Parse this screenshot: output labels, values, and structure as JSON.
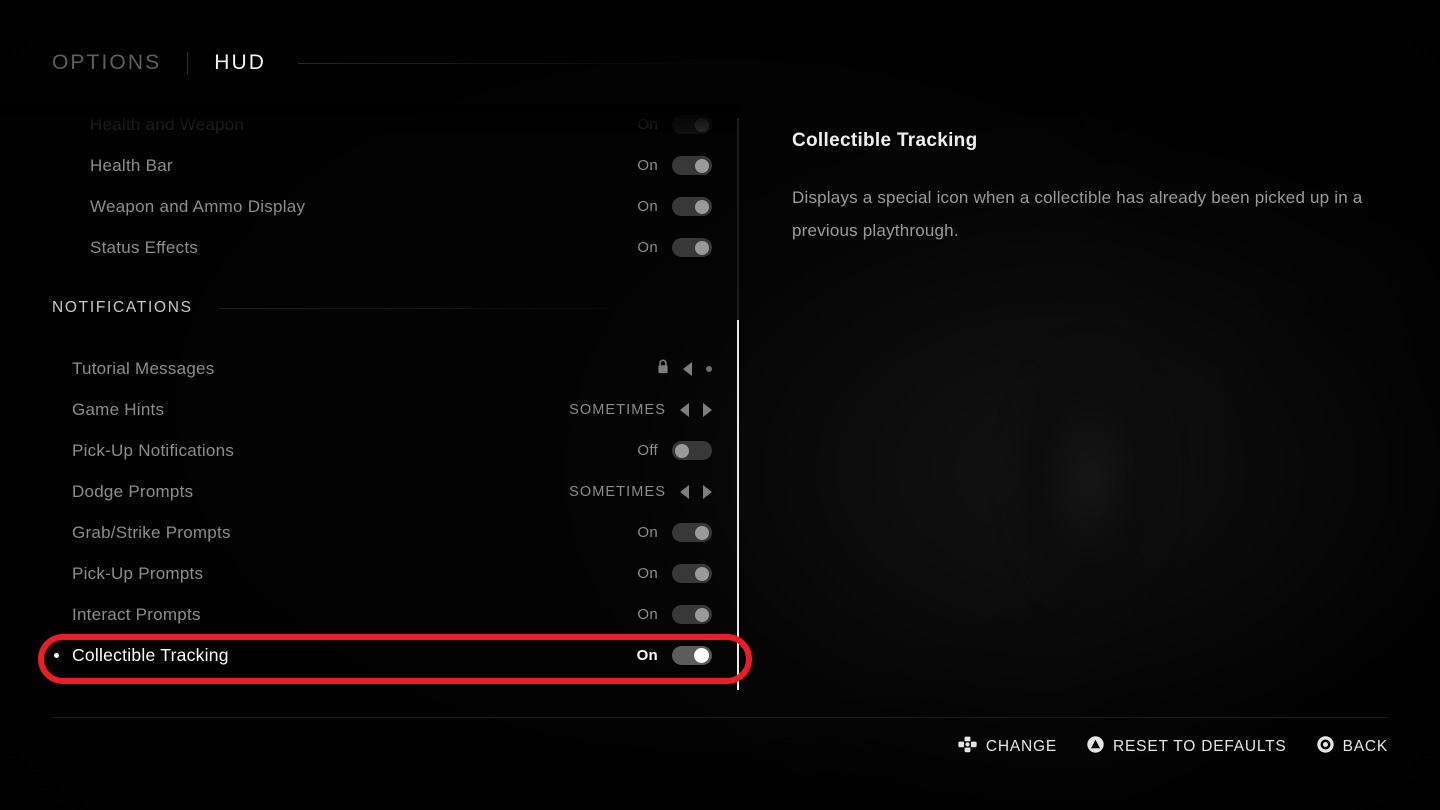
{
  "header": {
    "tab_inactive": "OPTIONS",
    "tab_active": "HUD"
  },
  "sections": {
    "clipped_row": {
      "label": "Health and Weapon",
      "value": "On"
    },
    "notifications_title": "NOTIFICATIONS"
  },
  "rows_top": [
    {
      "label": "Health Bar",
      "value": "On",
      "control": "toggle",
      "state": "on"
    },
    {
      "label": "Weapon and Ammo Display",
      "value": "On",
      "control": "toggle",
      "state": "on"
    },
    {
      "label": "Status Effects",
      "value": "On",
      "control": "toggle",
      "state": "on"
    }
  ],
  "rows_notifications": [
    {
      "label": "Tutorial Messages",
      "value": "",
      "control": "locked-spinner",
      "icon": "lock-icon"
    },
    {
      "label": "Game Hints",
      "value": "SOMETIMES",
      "control": "spinner"
    },
    {
      "label": "Pick-Up Notifications",
      "value": "Off",
      "control": "toggle",
      "state": "off"
    },
    {
      "label": "Dodge Prompts",
      "value": "SOMETIMES",
      "control": "spinner"
    },
    {
      "label": "Grab/Strike Prompts",
      "value": "On",
      "control": "toggle",
      "state": "on"
    },
    {
      "label": "Pick-Up Prompts",
      "value": "On",
      "control": "toggle",
      "state": "on"
    },
    {
      "label": "Interact Prompts",
      "value": "On",
      "control": "toggle",
      "state": "on"
    },
    {
      "label": "Collectible Tracking",
      "value": "On",
      "control": "toggle",
      "state": "on",
      "selected": true
    }
  ],
  "detail": {
    "title": "Collectible Tracking",
    "description": "Displays a special icon when a collectible has already been picked up in a previous playthrough."
  },
  "actions": [
    {
      "icon": "dpad-icon",
      "label": "CHANGE"
    },
    {
      "icon": "triangle-button-icon",
      "label": "RESET TO DEFAULTS"
    },
    {
      "icon": "circle-button-icon",
      "label": "BACK"
    }
  ],
  "colors": {
    "accent_annotation": "#ee1c25",
    "text_active": "#ffffff",
    "text_dim": "#8c8c8c",
    "background": "#000000"
  }
}
